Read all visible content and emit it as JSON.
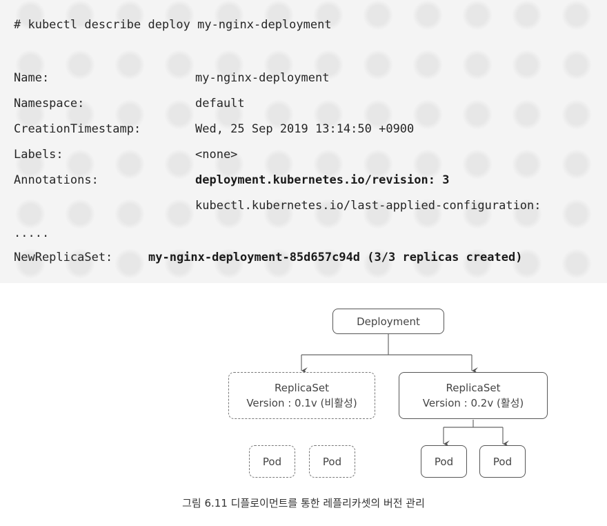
{
  "command": "# kubectl describe deploy my-nginx-deployment",
  "fields": {
    "name": {
      "label": "Name:",
      "value": "my-nginx-deployment"
    },
    "namespace": {
      "label": "Namespace:",
      "value": "default"
    },
    "creation": {
      "label": "CreationTimestamp:",
      "value": "Wed, 25 Sep 2019 13:14:50 +0900"
    },
    "labels": {
      "label": "Labels:",
      "value": "<none>"
    },
    "annotations": {
      "label": "Annotations:",
      "value1": "deployment.kubernetes.io/revision: 3",
      "value2": "kubectl.kubernetes.io/last-applied-configuration:"
    },
    "ellipsis": ".....",
    "newreplicaset": {
      "label": "NewReplicaSet:",
      "value": "my-nginx-deployment-85d657c94d (3/3 replicas created)"
    }
  },
  "diagram": {
    "deployment": "Deployment",
    "rs_old": {
      "title": "ReplicaSet",
      "version": "Version : 0.1v (비활성)"
    },
    "rs_new": {
      "title": "ReplicaSet",
      "version": "Version : 0.2v (활성)"
    },
    "pod": "Pod"
  },
  "caption": "그림 6.11 디플로이먼트를 통한 레플리카셋의 버전 관리"
}
